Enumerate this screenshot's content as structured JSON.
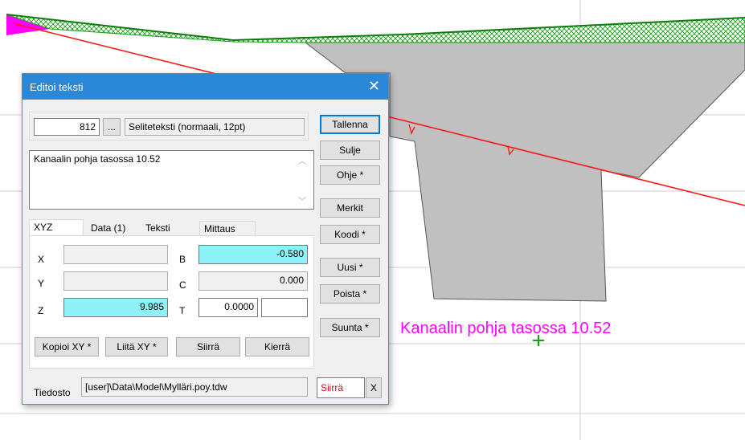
{
  "colors": {
    "magenta": "#ff00ff",
    "green": "#1a9e1a",
    "red": "#ff1a1a",
    "gray_fill": "#c0c0c0",
    "titlebar": "#2b88d8",
    "cyan_field": "#8ef3f8"
  },
  "canvas": {
    "label_text": "Kanaalin pohja tasossa 10.52"
  },
  "dialog": {
    "title": "Editoi teksti",
    "close_glyph": "✕",
    "code_value": "812",
    "browse_label": "...",
    "style_value": "Seliteteksti (normaali, 12pt)",
    "memo_text": "Kanaalin pohja tasossa 10.52",
    "tabs": [
      "XYZ",
      "Data (1)",
      "Teksti",
      "Mittaus"
    ],
    "coords": {
      "x_label": "X",
      "x_value": "",
      "y_label": "Y",
      "y_value": "",
      "z_label": "Z",
      "z_value": "9.985",
      "b_label": "B",
      "b_value": "-0.580",
      "c_label": "C",
      "c_value": "0.000",
      "t_label": "T",
      "t_value": "0.0000",
      "t_extra": ""
    },
    "bottom_buttons": [
      "Kopioi XY *",
      "Liitä XY *",
      "Siirrä",
      "Kierrä"
    ],
    "file_label": "Tiedosto",
    "file_value": "[user]\\Data\\Model\\Mylläri.poy.tdw",
    "file_move": "Siirrä",
    "file_x": "X",
    "right_buttons": [
      "Tallenna",
      "Sulje",
      "Ohje *",
      "Merkit",
      "Koodi *",
      "Uusi *",
      "Poista *",
      "Suunta *"
    ]
  }
}
